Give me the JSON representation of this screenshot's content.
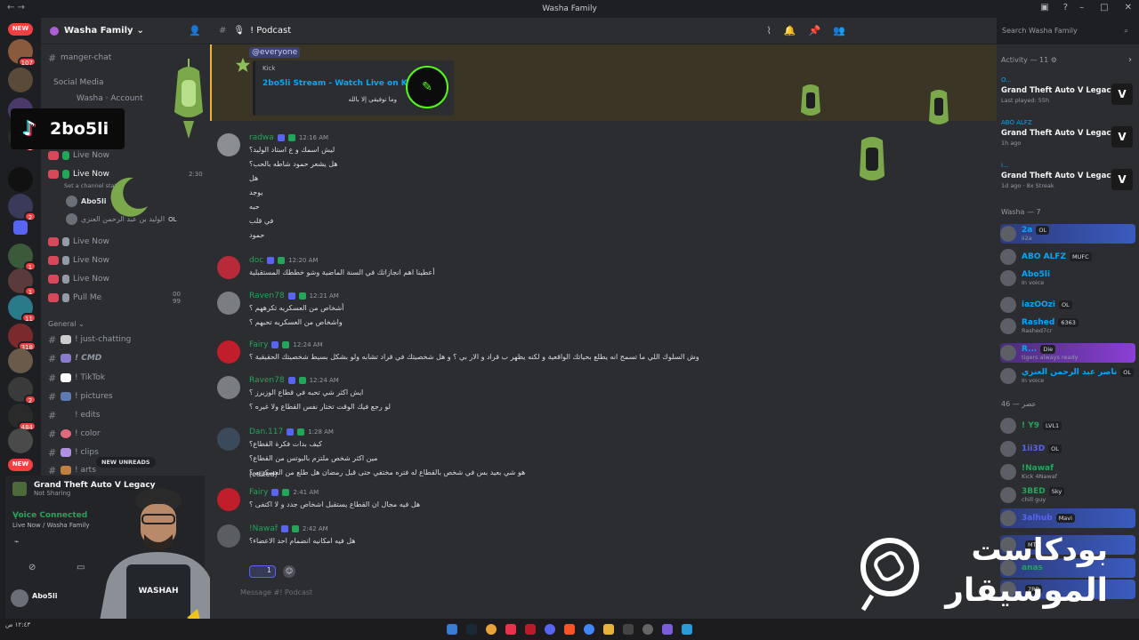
{
  "window": {
    "title": "Washa Family",
    "search_placeholder": "Search Washa Family"
  },
  "servers": {
    "new_badge": "NEW",
    "badges": [
      "107",
      "8",
      "9",
      "2",
      "1",
      "1",
      "11",
      "318",
      "2",
      "484"
    ],
    "new_badge_bottom": "NEW"
  },
  "guild": {
    "name": "Washa Family"
  },
  "channels": {
    "items": [
      {
        "label": "manger-chat"
      },
      {
        "label": "Social Media"
      },
      {
        "label": "Washa · Account"
      },
      {
        "label": "Live Now"
      },
      {
        "label": "Live Now"
      },
      {
        "label": "Set a channel status"
      },
      {
        "label": "Live Now"
      },
      {
        "label": "Live Now"
      },
      {
        "label": "Live Now"
      },
      {
        "label": "Pull Me"
      }
    ],
    "live_time": "2:30",
    "voice_user_1": "Abo5li",
    "voice_user_2": "الوليد بن عبد الرحمن العنزي",
    "voice_user_2_tag": "OL",
    "pull_counts": [
      "00",
      "99"
    ],
    "general_label": "General",
    "general": [
      "! just-chatting",
      "! CMD",
      "! TikTok",
      "! pictures",
      "! edits",
      "! color",
      "! clips",
      "! arts"
    ],
    "new_unreads": "NEW UNREADS"
  },
  "tiktok": {
    "handle": "2bo5li"
  },
  "user_panel": {
    "game": "Grand Theft Auto V Legacy",
    "game_sub": "Not Sharing",
    "voice_status": "Voice Connected",
    "voice_channel": "Live Now / Washa Family",
    "username": "Abo5li",
    "vest_text": "WASHAH"
  },
  "channel_header": {
    "name": "! Podcast"
  },
  "pinned": {
    "mention": "@everyone",
    "provider": "Kick",
    "title": "2bo5li Stream - Watch Live on Kick",
    "desc": "وما توفيقي إلا بالله"
  },
  "messages": [
    {
      "author": "radwa",
      "color": "#23a55a",
      "time": "12:16 AM",
      "lines": [
        "ليش اسمك و ع استاد الوليد؟",
        "هل يشعر حمود شاطه بالحب؟",
        "هل",
        "يوجد",
        "حبه",
        "في قلب",
        "حمود"
      ]
    },
    {
      "author": "doc",
      "color": "#23a55a",
      "time": "12:20 AM",
      "lines": [
        "أعطينا اهم انجازاتك في السنة الماضية وشو خططك المستقبلية"
      ]
    },
    {
      "author": "Raven78",
      "color": "#23a55a",
      "time": "12:21 AM",
      "lines": [
        "أشخاص من العسكريه تكرههم ؟",
        "واشخاص من العسكريه تحبهم ؟"
      ]
    },
    {
      "author": "Fairy",
      "color": "#23a55a",
      "time": "12:24 AM",
      "lines": [
        "وش السلوك اللي ما تسمح انه يطلع بحياتك الواقعية و لكنه يظهر ب قراد و الار بي ؟ و هل شخصيتك في قراد تشابه ولو بشكل بسيط شخصيتك الحقيقية ؟"
      ]
    },
    {
      "author": "Raven78",
      "color": "#23a55a",
      "time": "12:24 AM",
      "lines": [
        "ايش اكثر شي تحبه في قطاع الوزيرز ؟",
        "لو رجع فيك الوقت تختار نفس القطاع ولا غيره ؟"
      ]
    },
    {
      "author": "Dan.117",
      "color": "#23a55a",
      "time": "1:28 AM",
      "lines": [
        "كيف بدات فكرة القطاع؟",
        "مين اكثر شخص ملتزم بالبوتس من القطاع؟",
        "هو شي بعيد بس في شخص بالقطاع له فتره مختفي حتى قبل رمضان هل طلع من العسكريه ؟"
      ],
      "edited": "(edited)"
    },
    {
      "author": "Fairy",
      "color": "#23a55a",
      "time": "2:41 AM",
      "lines": [
        "هل فيه مجال ان القطاع يستقبل اشخاص جدد و لا اكتفى ؟"
      ]
    },
    {
      "author": "!Nawaf",
      "color": "#23a55a",
      "time": "2:42 AM",
      "lines": [
        "هل فيه امكانيه انضمام احد الاعضاء؟"
      ],
      "reaction_count": "1"
    }
  ],
  "composer": {
    "placeholder": "Message #! Podcast"
  },
  "activity": {
    "header": "Activity — 11",
    "items": [
      {
        "top": "O...",
        "game": "Grand Theft Auto V Legacy",
        "sub": "Last played: 55h"
      },
      {
        "top": "ABO ALFZ",
        "game": "Grand Theft Auto V Legacy",
        "sub": "1h ago"
      },
      {
        "top": "i...",
        "game": "Grand Theft Auto V Legacy",
        "sub": "1d ago · 8x Streak"
      }
    ]
  },
  "member_groups": [
    {
      "label": "Washa — 7",
      "members": [
        {
          "name": "2a",
          "color": "#00a8fc",
          "tag": "OL",
          "sub": "ii2a"
        },
        {
          "name": "ABO ALFZ",
          "color": "#00a8fc",
          "tag": "MUFC",
          "sub": ""
        },
        {
          "name": "Abo5li",
          "color": "#00a8fc",
          "tag": "",
          "sub": "In voice"
        },
        {
          "name": "iazOOzi",
          "color": "#00a8fc",
          "tag": "OL",
          "sub": ""
        },
        {
          "name": "Rashed",
          "color": "#00a8fc",
          "tag": "6363",
          "sub": "Rashed7cr"
        },
        {
          "name": "R...",
          "color": "#00a8fc",
          "tag": "Die",
          "sub": "tigers always ready"
        },
        {
          "name": "ناصر عبد الرحمن العنزي",
          "color": "#00a8fc",
          "tag": "OL",
          "sub": "In voice"
        }
      ]
    },
    {
      "label": "عصر — 46",
      "members": [
        {
          "name": "! Y9",
          "color": "#23a55a",
          "tag": "LVL1",
          "sub": ""
        },
        {
          "name": "1ii3D",
          "color": "#5865f2",
          "tag": "OL",
          "sub": ""
        },
        {
          "name": "!Nawaf",
          "color": "#23a55a",
          "tag": "",
          "sub": "Kick 4Nawaf"
        },
        {
          "name": "3BED",
          "color": "#23a55a",
          "tag": "Sky",
          "sub": "chill guy"
        },
        {
          "name": "3alhub",
          "color": "#5865f2",
          "tag": "Mavi",
          "sub": ""
        },
        {
          "name": "",
          "color": "#23a55a",
          "tag": "MT",
          "sub": ""
        },
        {
          "name": "anas",
          "color": "#23a55a",
          "tag": "",
          "sub": ""
        },
        {
          "name": "",
          "color": "#23a55a",
          "tag": "7RB",
          "sub": ""
        }
      ]
    }
  ],
  "overlay": {
    "podcast_logo_line1": "بودكاست",
    "podcast_logo_line2": "الموسيقار"
  },
  "taskbar": {
    "clock": "١٢:٤٣ ص"
  }
}
